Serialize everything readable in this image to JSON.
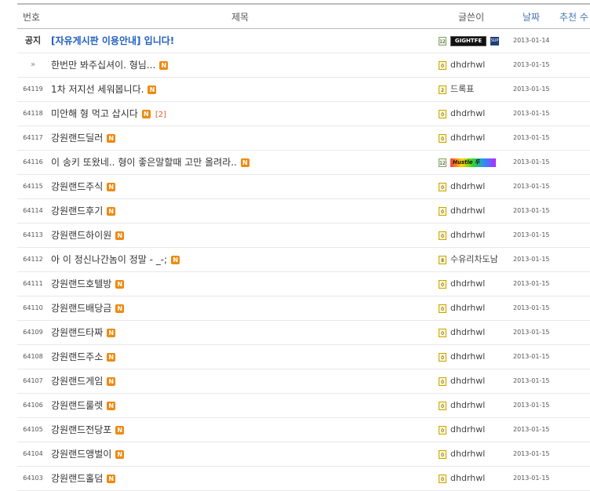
{
  "header": {
    "number": "번호",
    "title": "제목",
    "author": "글쓴이",
    "date": "날짜",
    "recommend": "추천 수"
  },
  "notice": {
    "number": "공지",
    "title": "[자유게시판 이용안내] 입니다!",
    "level": "12",
    "nick_image_text": "GIGHTFE",
    "badge_text": "SUP",
    "date": "2013-01-14"
  },
  "rows": [
    {
      "number": "»",
      "title": "한번만 봐주십셔이. 형님...",
      "new": "N",
      "comments": "",
      "level": "0",
      "author": "dhdrhwl",
      "date": "2013-01-15"
    },
    {
      "number": "64119",
      "title": "1차 저지선 세워봅니다.",
      "new": "N",
      "comments": "",
      "level": "2",
      "author": "드록표",
      "date": "2013-01-15"
    },
    {
      "number": "64118",
      "title": "미안해 형 먹고 삽시다",
      "new": "N",
      "comments": "[2]",
      "level": "0",
      "author": "dhdrhwl",
      "date": "2013-01-15"
    },
    {
      "number": "64117",
      "title": "강원랜드딜러",
      "new": "N",
      "comments": "",
      "level": "0",
      "author": "dhdrhwl",
      "date": "2013-01-15"
    },
    {
      "number": "64116",
      "title": "이 송키 또왔네.. 형이 좋은말할때 고만 올려라..",
      "new": "N",
      "comments": "",
      "level": "12",
      "author": "Hustle 두",
      "date": "2013-01-15"
    },
    {
      "number": "64115",
      "title": "강원랜드주식",
      "new": "N",
      "comments": "",
      "level": "0",
      "author": "dhdrhwl",
      "date": "2013-01-15"
    },
    {
      "number": "64114",
      "title": "강원랜드후기",
      "new": "N",
      "comments": "",
      "level": "0",
      "author": "dhdrhwl",
      "date": "2013-01-15"
    },
    {
      "number": "64113",
      "title": "강원랜드하이원",
      "new": "N",
      "comments": "",
      "level": "0",
      "author": "dhdrhwl",
      "date": "2013-01-15"
    },
    {
      "number": "64112",
      "title": "아 이 정신나간놈이 정말 - _-;",
      "new": "N",
      "comments": "",
      "level": "8",
      "author": "수유리차도남",
      "date": "2013-01-15"
    },
    {
      "number": "64111",
      "title": "강원랜드호텔방",
      "new": "N",
      "comments": "",
      "level": "0",
      "author": "dhdrhwl",
      "date": "2013-01-15"
    },
    {
      "number": "64110",
      "title": "강원랜드배당금",
      "new": "N",
      "comments": "",
      "level": "0",
      "author": "dhdrhwl",
      "date": "2013-01-15"
    },
    {
      "number": "64109",
      "title": "강원랜드타짜",
      "new": "N",
      "comments": "",
      "level": "0",
      "author": "dhdrhwl",
      "date": "2013-01-15"
    },
    {
      "number": "64108",
      "title": "강원랜드주소",
      "new": "N",
      "comments": "",
      "level": "0",
      "author": "dhdrhwl",
      "date": "2013-01-15"
    },
    {
      "number": "64107",
      "title": "강원랜드게임",
      "new": "N",
      "comments": "",
      "level": "0",
      "author": "dhdrhwl",
      "date": "2013-01-15"
    },
    {
      "number": "64106",
      "title": "강원랜드룰렛",
      "new": "N",
      "comments": "",
      "level": "0",
      "author": "dhdrhwl",
      "date": "2013-01-15"
    },
    {
      "number": "64105",
      "title": "강원랜드전당포",
      "new": "N",
      "comments": "",
      "level": "0",
      "author": "dhdrhwl",
      "date": "2013-01-15"
    },
    {
      "number": "64104",
      "title": "강원랜드앵벌이",
      "new": "N",
      "comments": "",
      "level": "0",
      "author": "dhdrhwl",
      "date": "2013-01-15"
    },
    {
      "number": "64103",
      "title": "강원랜드홀덤",
      "new": "N",
      "comments": "",
      "level": "0",
      "author": "dhdrhwl",
      "date": "2013-01-15"
    }
  ],
  "colors": {
    "notice_title": "#1f5fbf",
    "new_badge": "#ee8a10",
    "comment_count": "#e25b2c",
    "header_sort": "#4a78b5"
  }
}
